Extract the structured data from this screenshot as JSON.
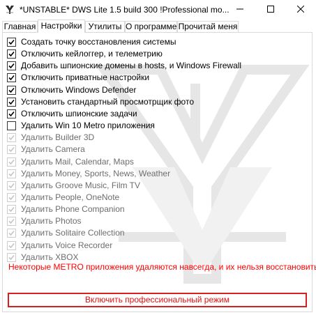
{
  "window": {
    "title": "*UNSTABLE* DWS Lite 1.5 build 300  !Professional mo...",
    "controls": {
      "minimize": "minimize-icon",
      "maximize": "maximize-icon",
      "close": "close-icon"
    }
  },
  "tabs": [
    {
      "label": "Главная",
      "active": false
    },
    {
      "label": "Настройки",
      "active": true
    },
    {
      "label": "Утилиты",
      "active": false
    },
    {
      "label": "О программе",
      "active": false
    },
    {
      "label": "Прочитай меня",
      "active": false
    }
  ],
  "options": [
    {
      "label": "Создать точку восстановления системы",
      "checked": true,
      "enabled": true
    },
    {
      "label": "Отключить кейлоггер, и телеметрию",
      "checked": true,
      "enabled": true
    },
    {
      "label": "Добавить шпионские домены в hosts, и Windows Firewall",
      "checked": true,
      "enabled": true
    },
    {
      "label": "Отключить приватные настройки",
      "checked": true,
      "enabled": true
    },
    {
      "label": "Отключить Windows Defender",
      "checked": true,
      "enabled": true
    },
    {
      "label": "Установить стандартный просмотрщик фото",
      "checked": true,
      "enabled": true
    },
    {
      "label": "Отключить шпионские задачи",
      "checked": true,
      "enabled": true
    },
    {
      "label": "Удалить Win 10 Metro приложения",
      "checked": false,
      "enabled": true
    },
    {
      "label": "Удалить Builder 3D",
      "checked": true,
      "enabled": false
    },
    {
      "label": "Удалить Camera",
      "checked": true,
      "enabled": false
    },
    {
      "label": "Удалить Mail, Calendar, Maps",
      "checked": true,
      "enabled": false
    },
    {
      "label": "Удалить Money, Sports, News, Weather",
      "checked": true,
      "enabled": false
    },
    {
      "label": "Удалить Groove Music, Film TV",
      "checked": true,
      "enabled": false
    },
    {
      "label": "Удалить People, OneNote",
      "checked": true,
      "enabled": false
    },
    {
      "label": "Удалить Phone Companion",
      "checked": true,
      "enabled": false
    },
    {
      "label": "Удалить Photos",
      "checked": true,
      "enabled": false
    },
    {
      "label": "Удалить Solitaire Collection",
      "checked": true,
      "enabled": false
    },
    {
      "label": "Удалить Voice Recorder",
      "checked": true,
      "enabled": false
    },
    {
      "label": "Удалить XBOX",
      "checked": true,
      "enabled": false
    }
  ],
  "warning": "Некоторые METRO приложения удаляются навсегда, и их нельзя восстановить",
  "pro_button": "Включить профессиональный режим",
  "colors": {
    "warning": "#ff0000",
    "pro_button_border": "#d61f1f",
    "disabled_text": "#6d6d6d"
  }
}
